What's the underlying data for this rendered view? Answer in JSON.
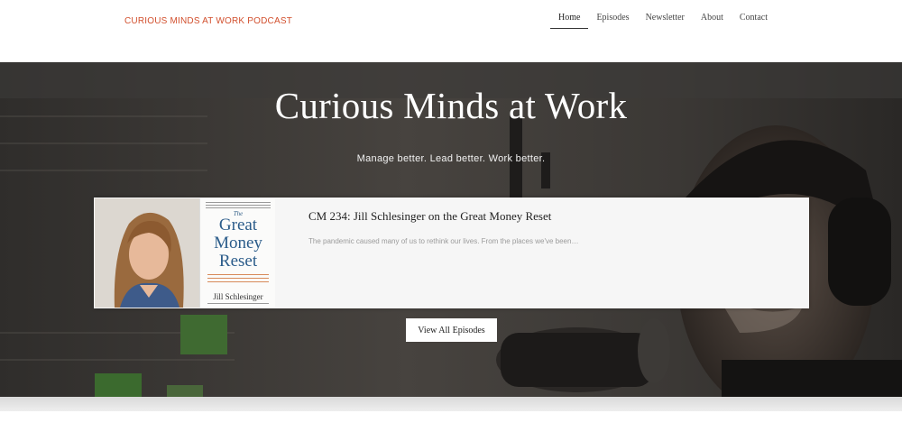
{
  "header": {
    "brand": "CURIOUS  MINDS AT WORK PODCAST",
    "nav": [
      {
        "label": "Home",
        "active": true
      },
      {
        "label": "Episodes",
        "active": false
      },
      {
        "label": "Newsletter",
        "active": false
      },
      {
        "label": "About",
        "active": false
      },
      {
        "label": "Contact",
        "active": false
      }
    ]
  },
  "hero": {
    "title": "Curious Minds at Work",
    "tagline": "Manage better. Lead better. Work better."
  },
  "featured_episode": {
    "title": "CM 234: Jill Schlesinger on the Great Money Reset",
    "excerpt": "The pandemic caused many of us to rethink our lives. From the places we've been…",
    "book": {
      "the": "The",
      "title_lines": [
        "Great",
        "Money",
        "Reset"
      ],
      "author": "Jill Schlesinger"
    }
  },
  "cta": {
    "view_all": "View All Episodes"
  },
  "colors": {
    "brand": "#d2502e",
    "book_blue": "#2b5c8a",
    "hero_dark": "#3a3735"
  }
}
